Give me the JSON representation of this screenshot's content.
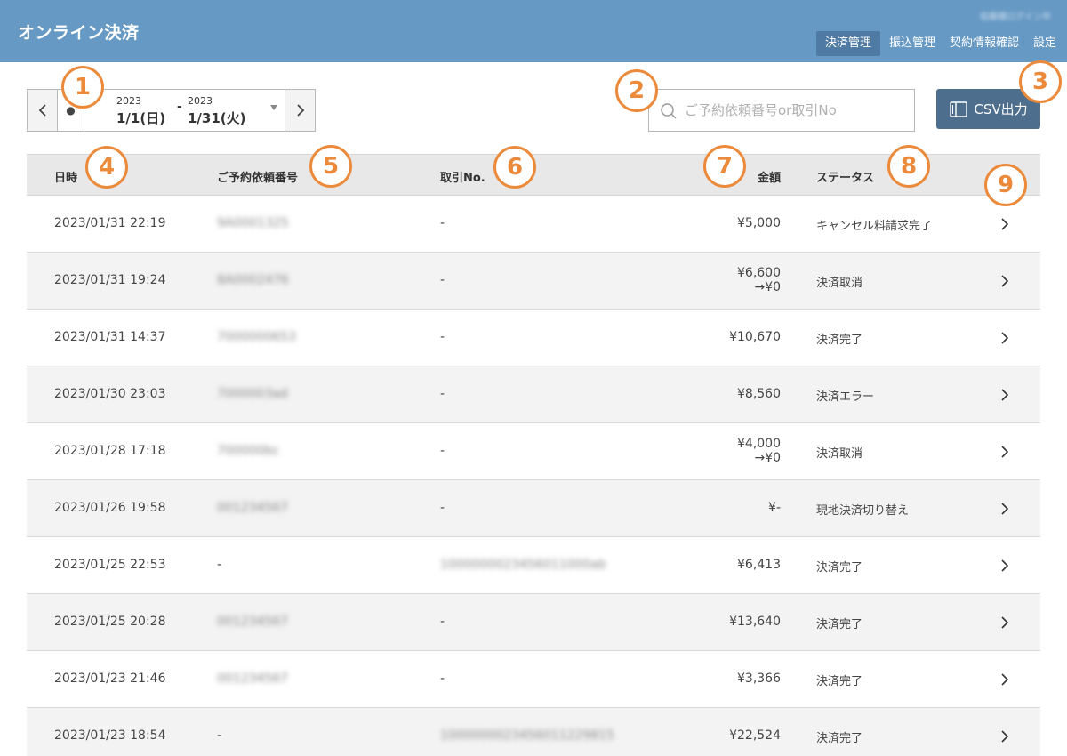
{
  "header": {
    "title": "オンライン決済",
    "user": "佐藤様ログイン中",
    "nav": [
      {
        "label": "決済管理",
        "active": true
      },
      {
        "label": "振込管理",
        "active": false
      },
      {
        "label": "契約情報確認",
        "active": false
      },
      {
        "label": "設定",
        "active": false
      }
    ]
  },
  "toolbar": {
    "date_start_year": "2023",
    "date_start": "1/1(日)",
    "date_sep": "-",
    "date_end_year": "2023",
    "date_end": "1/31(火)",
    "search_placeholder": "ご予約依頼番号or取引No",
    "csv_label": "CSV出力"
  },
  "table": {
    "headers": {
      "date": "日時",
      "request_no": "ご予約依頼番号",
      "transaction_no": "取引No.",
      "amount": "金額",
      "status": "ステータス"
    },
    "rows": [
      {
        "date": "2023/01/31 22:19",
        "request_no": "9A0001325",
        "transaction_no": "-",
        "amount": "¥5,000",
        "amount_after": "",
        "status": "キャンセル料請求完了"
      },
      {
        "date": "2023/01/31 19:24",
        "request_no": "8A0002476",
        "transaction_no": "-",
        "amount": "¥6,600",
        "amount_after": "→¥0",
        "status": "決済取消"
      },
      {
        "date": "2023/01/31 14:37",
        "request_no": "7000000653",
        "transaction_no": "-",
        "amount": "¥10,670",
        "amount_after": "",
        "status": "決済完了"
      },
      {
        "date": "2023/01/30 23:03",
        "request_no": "7000003ad",
        "transaction_no": "-",
        "amount": "¥8,560",
        "amount_after": "",
        "status": "決済エラー"
      },
      {
        "date": "2023/01/28 17:18",
        "request_no": "700000bc",
        "transaction_no": "-",
        "amount": "¥4,000",
        "amount_after": "→¥0",
        "status": "決済取消"
      },
      {
        "date": "2023/01/26 19:58",
        "request_no": "001234567",
        "transaction_no": "-",
        "amount": "¥-",
        "amount_after": "",
        "status": "現地決済切り替え"
      },
      {
        "date": "2023/01/25 22:53",
        "request_no": "-",
        "transaction_no": "1000000023456011000ab",
        "amount": "¥6,413",
        "amount_after": "",
        "status": "決済完了"
      },
      {
        "date": "2023/01/25 20:28",
        "request_no": "001234567",
        "transaction_no": "-",
        "amount": "¥13,640",
        "amount_after": "",
        "status": "決済完了"
      },
      {
        "date": "2023/01/23 21:46",
        "request_no": "001234567",
        "transaction_no": "-",
        "amount": "¥3,366",
        "amount_after": "",
        "status": "決済完了"
      },
      {
        "date": "2023/01/23 18:54",
        "request_no": "-",
        "transaction_no": "1000000023456011229815",
        "amount": "¥22,524",
        "amount_after": "",
        "status": "決済完了"
      }
    ]
  },
  "callouts": [
    "1",
    "2",
    "3",
    "4",
    "5",
    "6",
    "7",
    "8",
    "9"
  ],
  "colors": {
    "header_bg": "#6699c4",
    "nav_active_bg": "#4f7aa3",
    "csv_button_bg": "#4e6e8e",
    "callout": "#ec8a3c",
    "table_header_bg": "#e8e8e8",
    "row_alt_bg": "#f3f3f3"
  },
  "icons": {
    "search": "search-icon",
    "csv": "book-icon",
    "prev": "chevron-left-icon",
    "next": "chevron-right-icon",
    "row_detail": "chevron-right-icon"
  }
}
